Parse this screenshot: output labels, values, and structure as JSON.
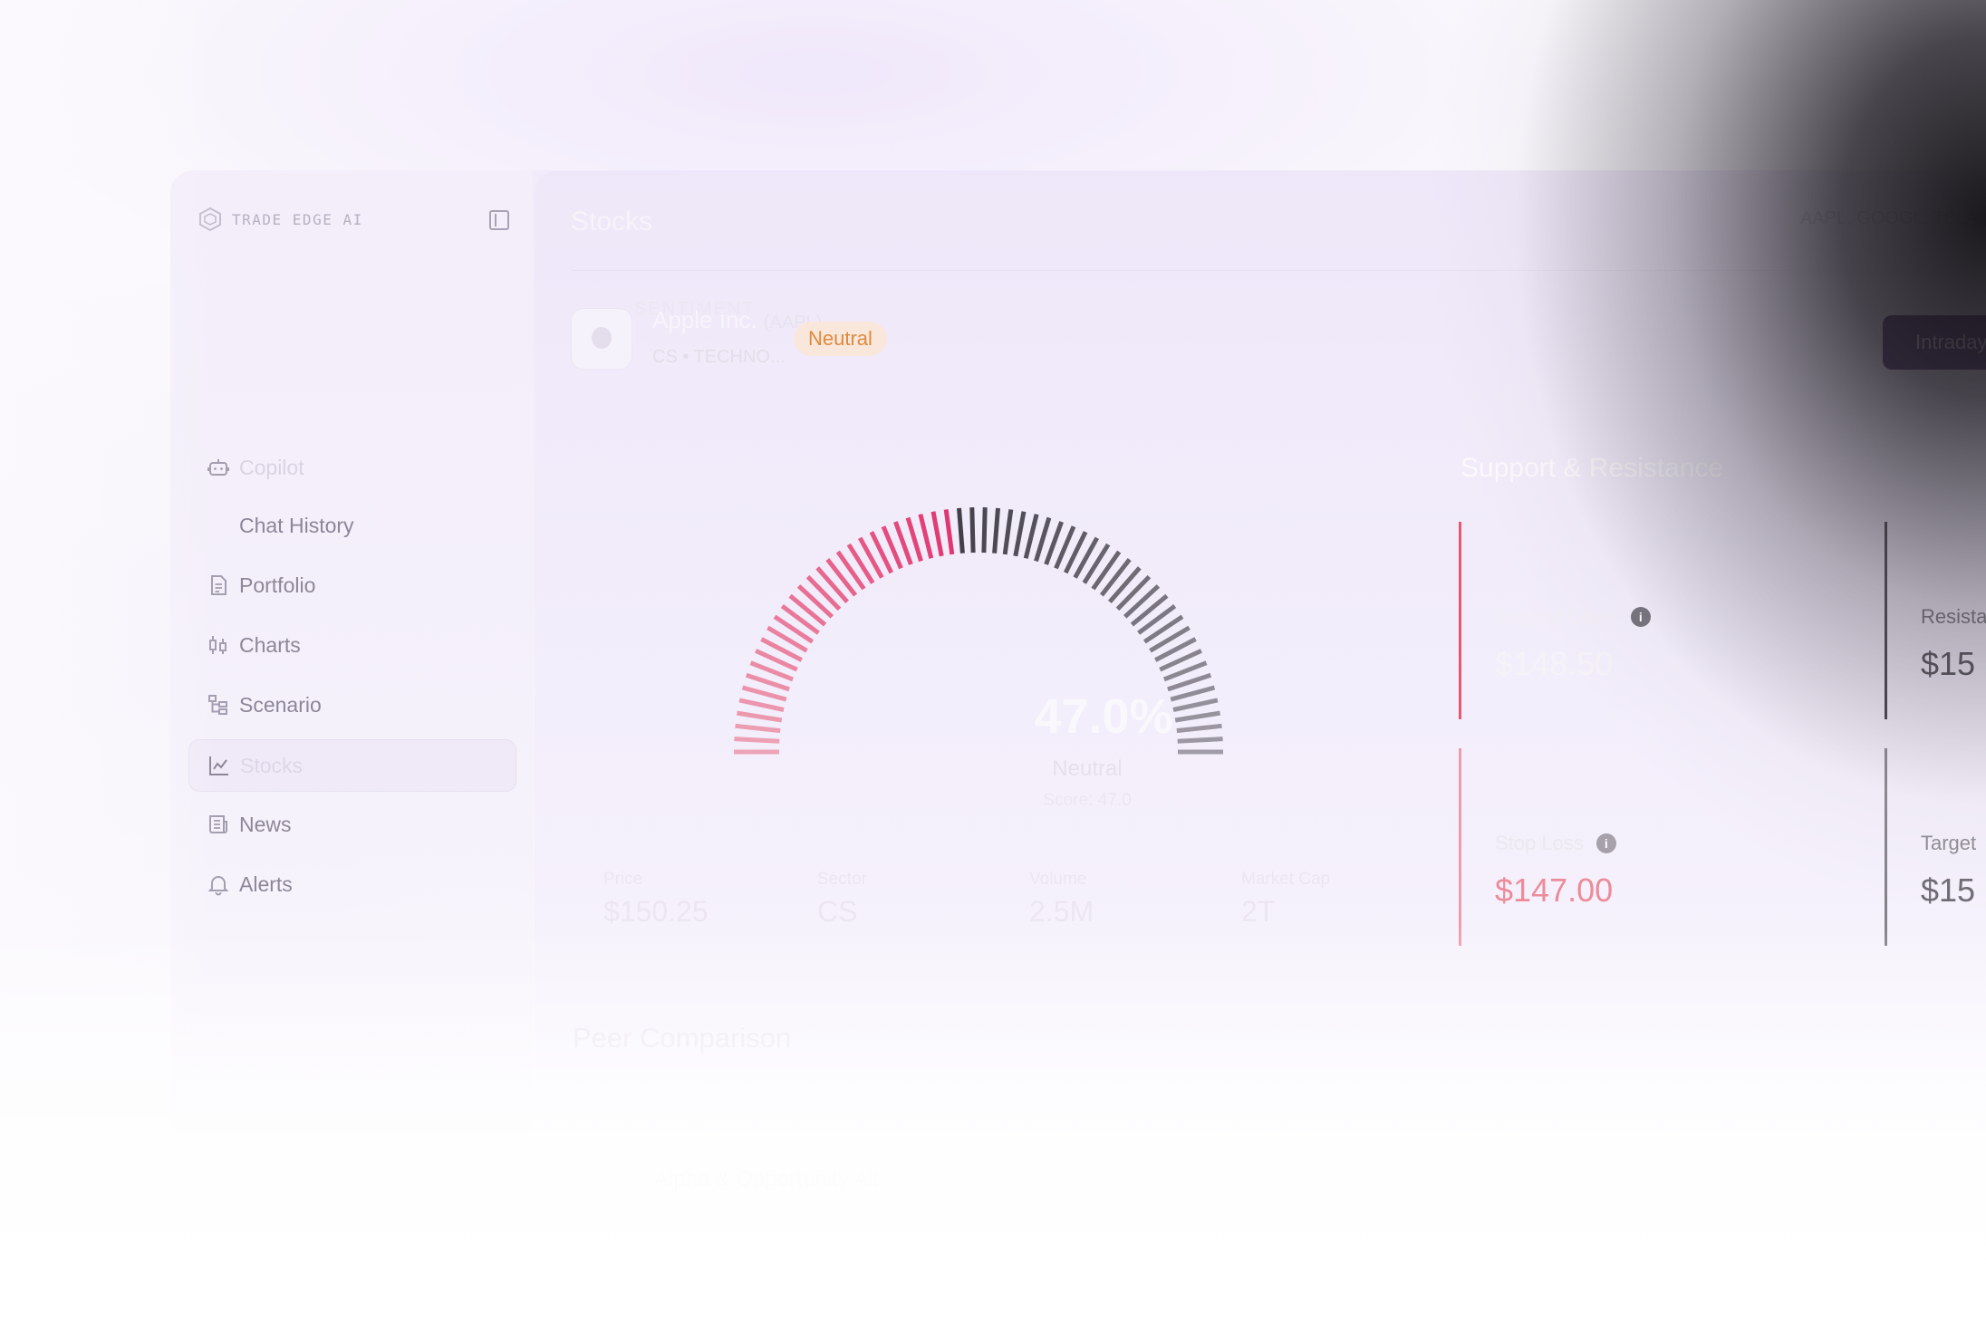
{
  "app": {
    "logo_text": "TRADE EDGE AI",
    "page_title": "Stocks",
    "search_text": "AAPL, GOOGL, TSLA..."
  },
  "sidebar": {
    "items": [
      {
        "label": "Copilot",
        "icon": "robot-icon"
      },
      {
        "label": "Chat History",
        "icon": ""
      },
      {
        "label": "Portfolio",
        "icon": "document-icon"
      },
      {
        "label": "Charts",
        "icon": "candlestick-icon"
      },
      {
        "label": "Scenario",
        "icon": "tree-icon"
      },
      {
        "label": "Stocks",
        "icon": "line-chart-icon"
      },
      {
        "label": "News",
        "icon": "newspaper-icon"
      },
      {
        "label": "Alerts",
        "icon": "bell-icon"
      }
    ]
  },
  "stock": {
    "name": "Apple Inc.",
    "ticker": "(AAPL)",
    "meta": "CS • TECHNO...",
    "sentiment": "Neutral",
    "action_button": "Intraday"
  },
  "gauge": {
    "title": "SENTIMENT",
    "percent_text": "47.0%",
    "percent": 47,
    "label": "Neutral",
    "score_text": "Score: 47.0",
    "colors": {
      "bearish": "#e8667e",
      "strong": "#e0336f",
      "neutral": "#3a3740"
    }
  },
  "stats": [
    {
      "label": "Price",
      "value": "$150.25"
    },
    {
      "label": "Sector",
      "value": "CS"
    },
    {
      "label": "Volume",
      "value": "2.5M"
    },
    {
      "label": "Market Cap",
      "value": "2T"
    }
  ],
  "support_resistance": {
    "title": "Support & Resistance",
    "cards": [
      {
        "label": "Support Level",
        "value": "$148.50",
        "color": "#e8576d"
      },
      {
        "label": "Resistance",
        "value": "$15",
        "color": "#3a3740"
      },
      {
        "label": "Stop Loss",
        "value": "$147.00",
        "color": "#e8576d"
      },
      {
        "label": "Target",
        "value": "$15",
        "color": "#3a3740"
      }
    ]
  },
  "peer": {
    "title": "Peer Comparison",
    "row_label": "Alpha & Opportunity Alt"
  }
}
